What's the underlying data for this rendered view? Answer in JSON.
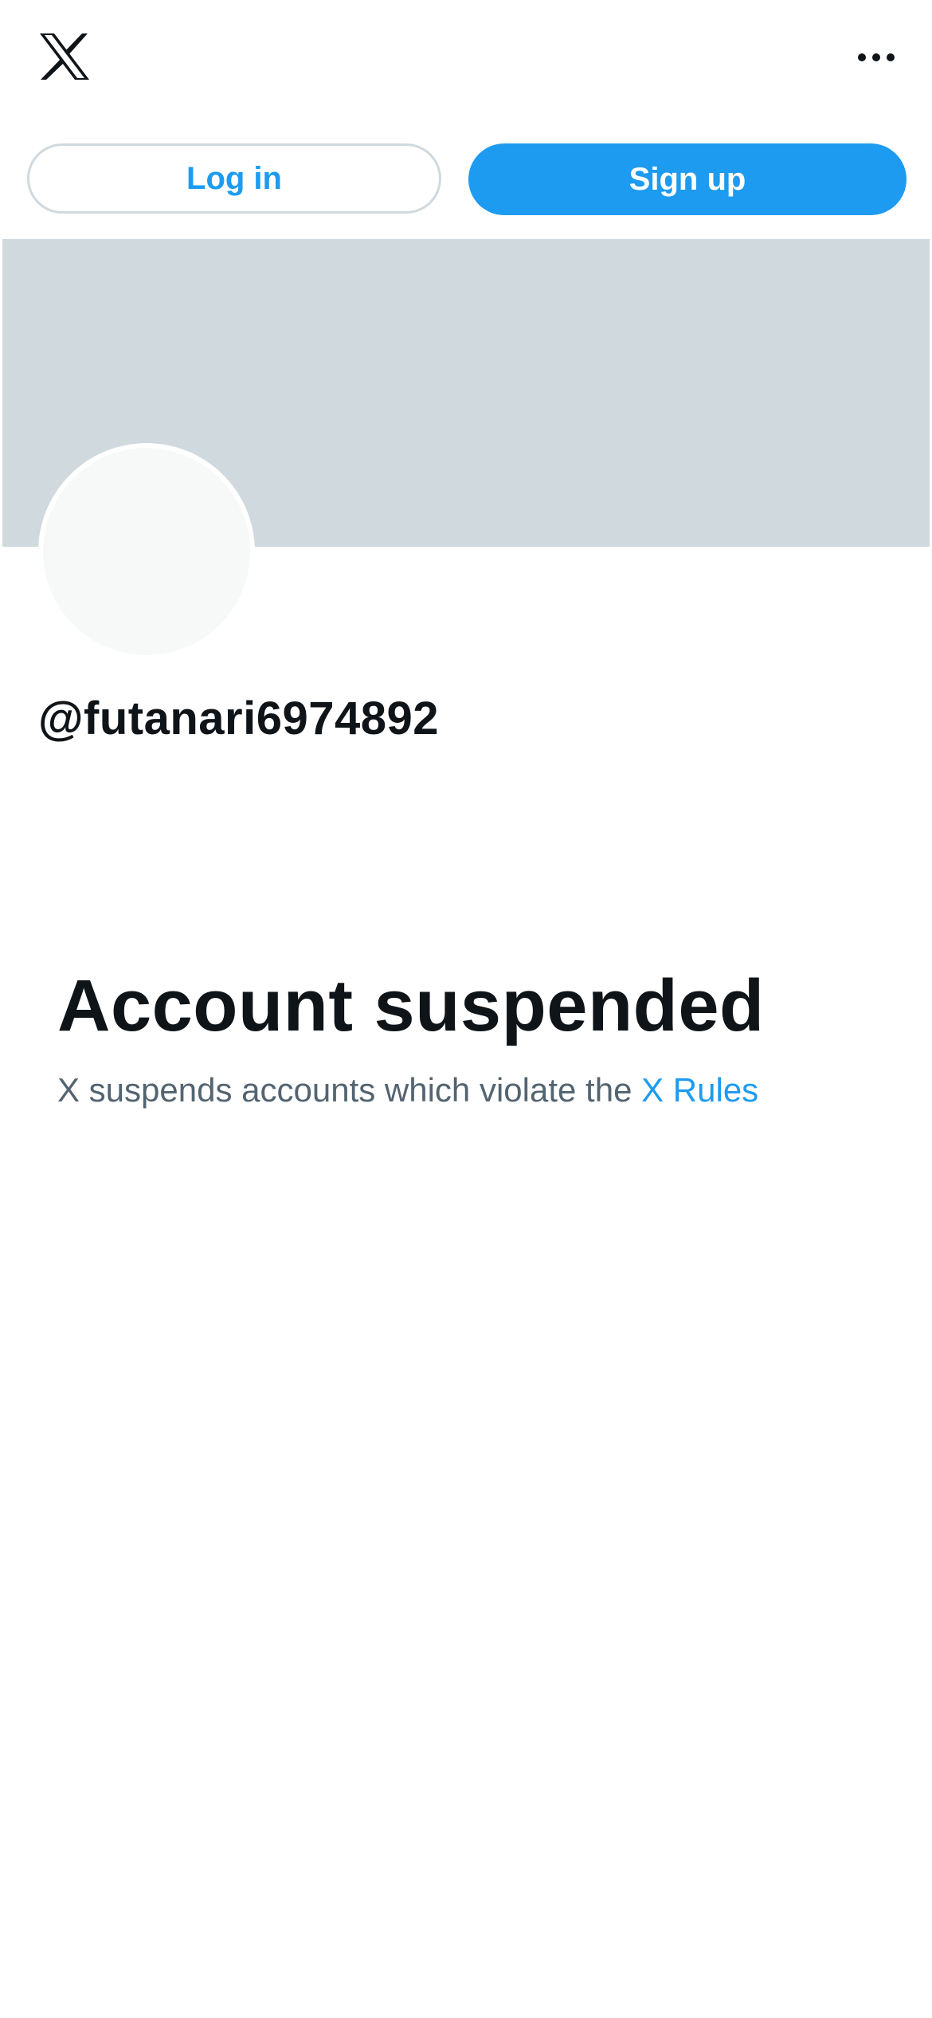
{
  "header": {
    "logo_icon": "x-logo-icon",
    "more_icon": "more-horizontal-icon"
  },
  "auth": {
    "login_label": "Log in",
    "signup_label": "Sign up"
  },
  "profile": {
    "handle": "@futanari6974892"
  },
  "suspension": {
    "title": "Account suspended",
    "message": "X suspends accounts which violate the",
    "link_text": "X Rules"
  },
  "colors": {
    "accent": "#1d9bf0",
    "banner": "#cfd9de",
    "text_primary": "#0f1419",
    "text_secondary": "#536471"
  }
}
